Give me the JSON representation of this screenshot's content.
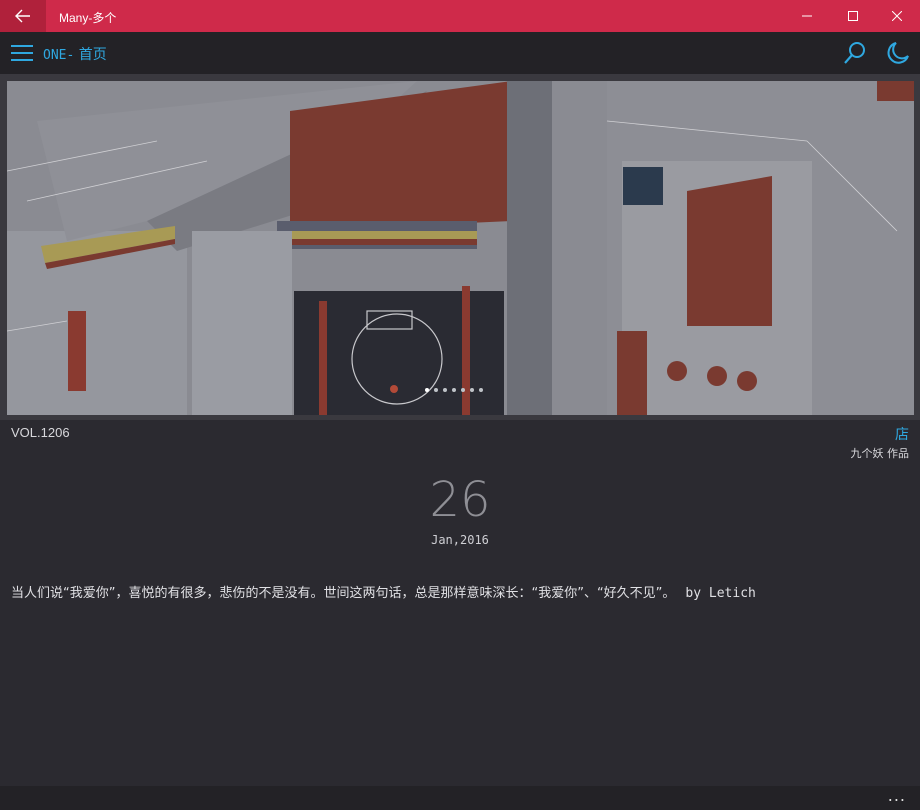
{
  "window": {
    "title": "Many-多个"
  },
  "app": {
    "brand": "ONE-",
    "page": "首页",
    "accent": "#2fa8e0"
  },
  "hero": {
    "slide_count": 7,
    "active_slide": 0
  },
  "meta": {
    "volume": "VOL.1206",
    "shop_label": "店",
    "author": "九个妖 作品"
  },
  "date": {
    "day": "26",
    "month_year": "Jan,2016"
  },
  "quote": {
    "text": "当人们说“我爱你”，喜悦的有很多，悲伤的不是没有。世间这两句话，总是那样意味深长：“我爱你”、“好久不见”。",
    "by": "by Letich"
  },
  "bottom": {
    "more_label": "..."
  },
  "colors": {
    "titlebar": "#cf2a4a",
    "appbar": "#232226",
    "background": "#2b2a30"
  }
}
